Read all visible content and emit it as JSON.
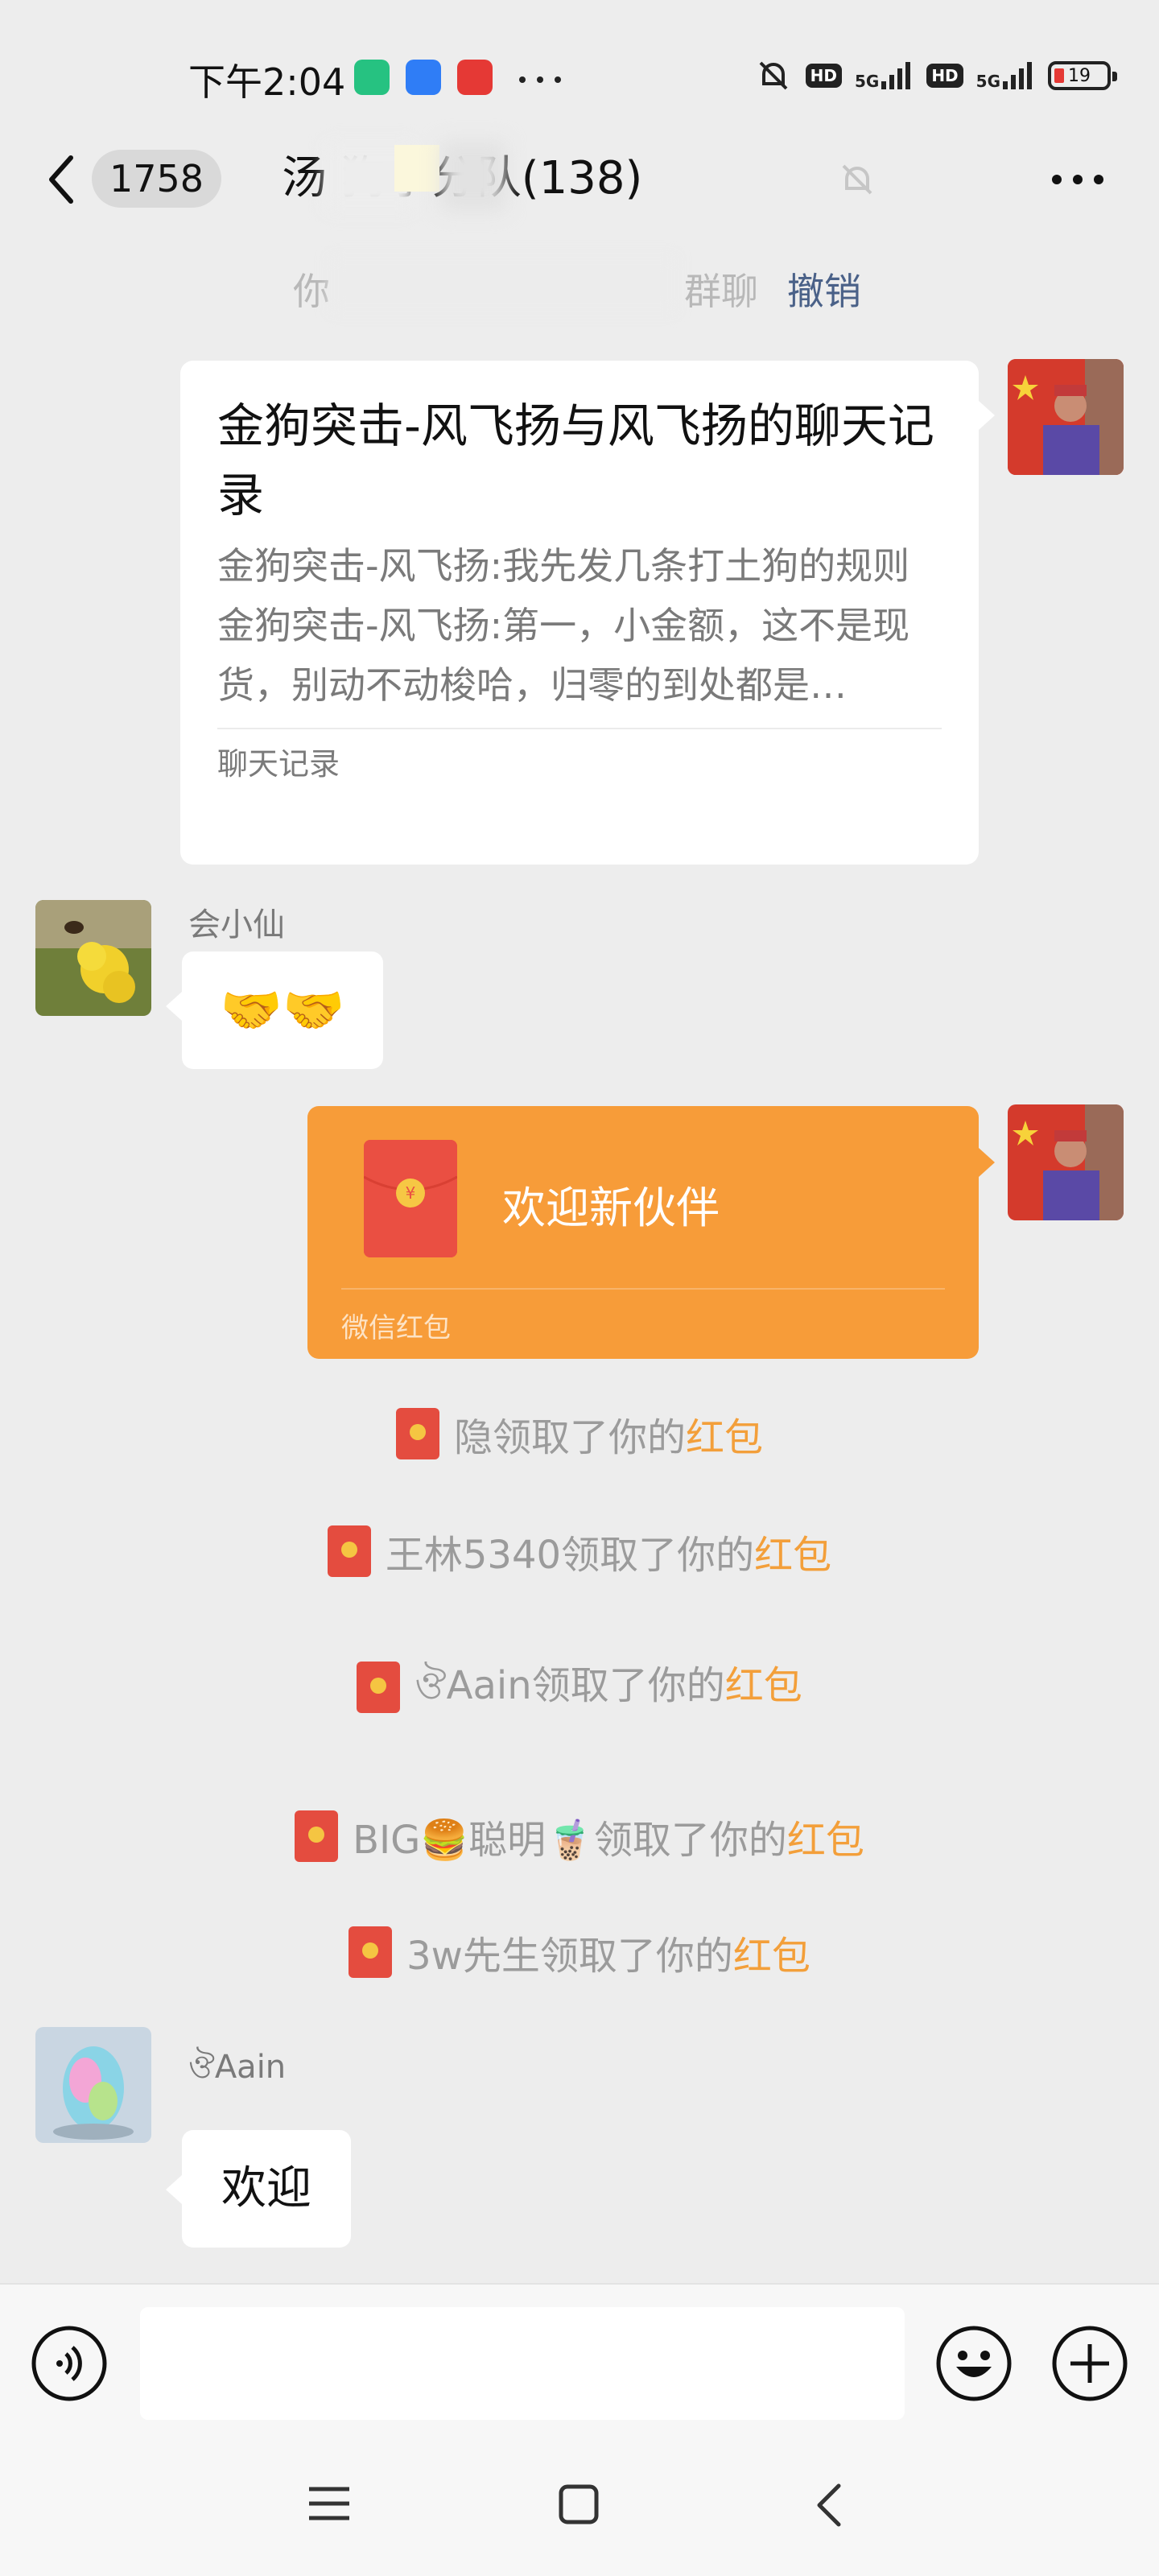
{
  "status_bar": {
    "time": "下午2:04",
    "hd": "HD",
    "network": "5G",
    "battery": "19"
  },
  "nav": {
    "unread_count": "1758",
    "title": "汤 狗小分队(138)"
  },
  "notice": {
    "left_text": "你",
    "right_text": "群聊",
    "action": "撤销"
  },
  "messages": {
    "chat_record": {
      "title": "金狗突击-风飞扬与风飞扬的聊天记录",
      "line1": "金狗突击-风飞扬:我先发几条打土狗的规则",
      "line2": "金狗突击-风飞扬:第一，小金额，这不是现货，别动不动梭哈，归零的到处都是…",
      "footer": "聊天记录"
    },
    "msg_huixiaoxian": {
      "sender": "会小仙",
      "content": "🤝🤝"
    },
    "red_packet": {
      "text": "欢迎新伙伴",
      "footer": "微信红包"
    },
    "system": [
      {
        "name": "隐",
        "suffix": "领取了你的",
        "word": "红包"
      },
      {
        "name": "王林5340",
        "suffix": "领取了你的",
        "word": "红包"
      },
      {
        "name": "ঔAain",
        "suffix": "领取了你的",
        "word": "红包"
      },
      {
        "name": "BIG🍔聪明🧋",
        "suffix": "领取了你的",
        "word": "红包"
      },
      {
        "name": "3w先生",
        "suffix": "领取了你的",
        "word": "红包"
      }
    ],
    "msg_aain": {
      "sender": "ঔAain",
      "content": "欢迎"
    }
  },
  "colors": {
    "background": "#ededed",
    "red_packet": "#f79c39",
    "link": "#4a6188",
    "red_packet_word": "#f39f3a"
  },
  "icons": [
    "back-chevron-icon",
    "mute-bell-icon",
    "more-icon",
    "voice-icon",
    "emoji-icon",
    "plus-icon",
    "menu-icon",
    "home-icon",
    "back-icon"
  ]
}
